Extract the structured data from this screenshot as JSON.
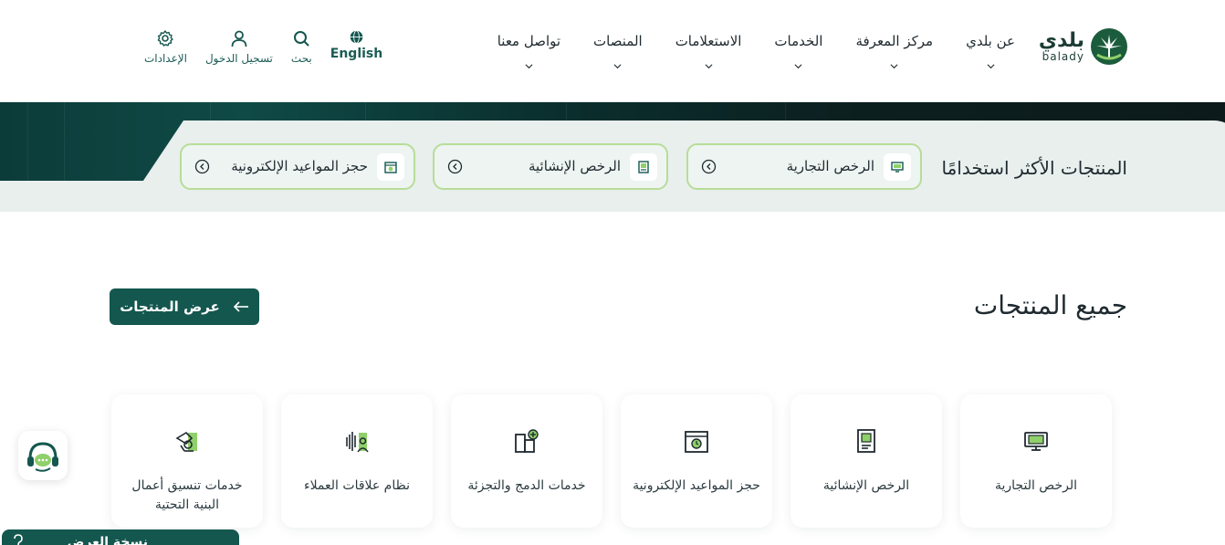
{
  "brand": {
    "logo_ar": "بلدي",
    "logo_en": "balady",
    "accent": "#14574f",
    "pop_border": "#b7dd98"
  },
  "nav": {
    "items": [
      {
        "label": "عن بلدي"
      },
      {
        "label": "مركز المعرفة"
      },
      {
        "label": "الخدمات"
      },
      {
        "label": "الاستعلامات"
      },
      {
        "label": "المنصات"
      },
      {
        "label": "تواصل معنا"
      }
    ]
  },
  "tools": {
    "language": "English",
    "search": "بحث",
    "login": "تسجيل الدخول",
    "settings": "الإعدادات"
  },
  "popular": {
    "title": "المنتجات الأكثر استخدامًا",
    "items": [
      {
        "label": "الرخص التجارية",
        "icon": "shop-icon"
      },
      {
        "label": "الرخص الإنشائية",
        "icon": "document-icon"
      },
      {
        "label": "حجز المواعيد الإلكترونية",
        "icon": "calendar-icon"
      }
    ]
  },
  "all_products": {
    "title": "جميع المنتجات",
    "view_button": "عرض المنتجات",
    "items": [
      {
        "label": "الرخص التجارية",
        "icon": "shop-icon"
      },
      {
        "label": "الرخص الإنشائية",
        "icon": "document-icon"
      },
      {
        "label": "حجز المواعيد الإلكترونية",
        "icon": "calendar-icon"
      },
      {
        "label": "خدمات الدمج والتجزئة",
        "icon": "building-plus-icon"
      },
      {
        "label": "نظام علاقات العملاء",
        "icon": "customer-icon"
      },
      {
        "label": "خدمات تنسيق أعمال البنية التحتية",
        "icon": "infrastructure-icon"
      }
    ]
  },
  "footer_bar": {
    "label": "نسخة العرض"
  }
}
